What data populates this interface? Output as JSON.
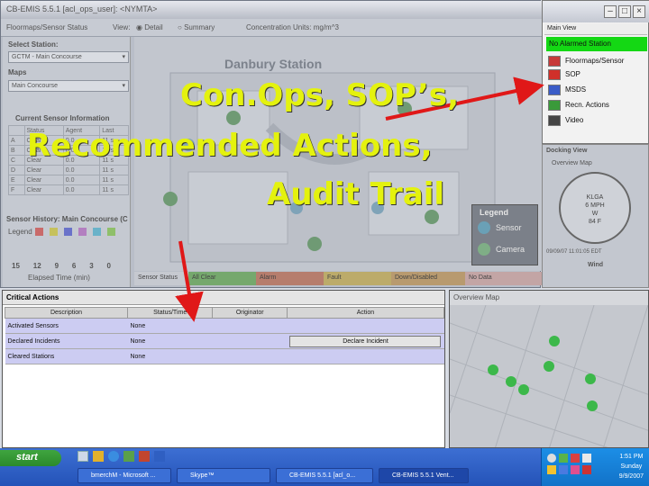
{
  "app": {
    "title": "CB-EMIS 5.5.1 [acl_ops_user]: <NYMTA>",
    "toolbar": {
      "menu": "Floormaps/Sensor Status",
      "view_label": "View:",
      "view_detail": "Detail",
      "view_summary": "Summary",
      "units": "Concentration Units: mg/m^3"
    },
    "left": {
      "select_station_label": "Select Station:",
      "station_value": "GCTM - Main Concourse",
      "maps_label": "Maps",
      "map_value": "Main Concourse",
      "current_sensor_label": "Current Sensor Information",
      "table_headers": [
        "",
        "Status",
        "Agent",
        "Last"
      ],
      "table_rows": [
        [
          "A",
          "Clear",
          "0.0",
          "11 s"
        ],
        [
          "B",
          "Clear",
          "0.0",
          "11 s"
        ],
        [
          "C",
          "Clear",
          "0.0",
          "11 s"
        ],
        [
          "D",
          "Clear",
          "0.0",
          "11 s"
        ],
        [
          "E",
          "Clear",
          "0.0",
          "11 s"
        ],
        [
          "F",
          "Clear",
          "0.0",
          "11 s"
        ]
      ],
      "history_label": "Sensor History: Main Concourse (C",
      "legend_label": "Legend",
      "legend_items": [
        {
          "letter": "A",
          "color": "#c96a6a"
        },
        {
          "letter": "B",
          "color": "#c6c15c"
        },
        {
          "letter": "C",
          "color": "#6a72c9"
        },
        {
          "letter": "D",
          "color": "#b37fc0"
        },
        {
          "letter": "E",
          "color": "#6ab2c9"
        },
        {
          "letter": "F",
          "color": "#8fbf6a"
        }
      ],
      "x_ticks": [
        "15",
        "12",
        "9",
        "6",
        "3",
        "0"
      ],
      "x_label": "Elapsed Time (min)"
    },
    "map": {
      "station_title": "Danbury Station",
      "legend_title": "Legend",
      "legend_sensor": "Sensor",
      "legend_camera": "Camera"
    },
    "status_strip": {
      "label": "Sensor Status",
      "all_clear": "All Clear",
      "alarm": "Alarm",
      "fault": "Fault",
      "down": "Down/Disabled",
      "no_data": "No Data"
    }
  },
  "main_view": {
    "header": "Main View",
    "alarm_status": "No Alarmed Station",
    "items": [
      {
        "label": "Floormaps/Sensor",
        "icon": "floormap-icon",
        "color": "#c73a3a"
      },
      {
        "label": "SOP",
        "icon": "sop-icon",
        "color": "#d0302a"
      },
      {
        "label": "MSDS",
        "icon": "msds-icon",
        "color": "#3a5cc7"
      },
      {
        "label": "Recn. Actions",
        "icon": "actions-icon",
        "color": "#3a9a3a"
      },
      {
        "label": "Video",
        "icon": "video-icon",
        "color": "#444444"
      }
    ]
  },
  "docking": {
    "header": "Docking View",
    "sub": "Overview Map",
    "compass_readout": "KLGA",
    "wind_speed": "6 MPH",
    "wind_dir": "W",
    "temp": "84 F",
    "date": "09/09/07 11:01:05 EDT",
    "wind_label": "Wind"
  },
  "critical": {
    "title": "Critical Actions",
    "headers": [
      "Description",
      "Status/Time",
      "Originator",
      "Action"
    ],
    "rows": [
      {
        "description": "Activated Sensors",
        "status": "None",
        "originator": "",
        "action": ""
      },
      {
        "description": "Declared Incidents",
        "status": "None",
        "originator": "",
        "action": "Declare Incident"
      },
      {
        "description": "Cleared Stations",
        "status": "None",
        "originator": "",
        "action": ""
      }
    ]
  },
  "overview": {
    "title": "Overview Map"
  },
  "taskbar": {
    "start": "start",
    "buttons": [
      {
        "label": "bmerchM - Microsoft ..."
      },
      {
        "label": "Skype™"
      },
      {
        "label": "CB-EMIS 5.5.1 [acl_o..."
      },
      {
        "label": "CB-EMIS 5.5.1 Vent..."
      }
    ],
    "clock_time": "1:51 PM",
    "clock_day": "Sunday",
    "clock_date": "9/9/2007"
  },
  "overlay": {
    "line1": "Con.Ops, SOP’s,",
    "line2": "Recommended Actions,",
    "line3": "Audit Trail",
    "color": "#e4f20e",
    "arrow_color": "#e01818"
  }
}
